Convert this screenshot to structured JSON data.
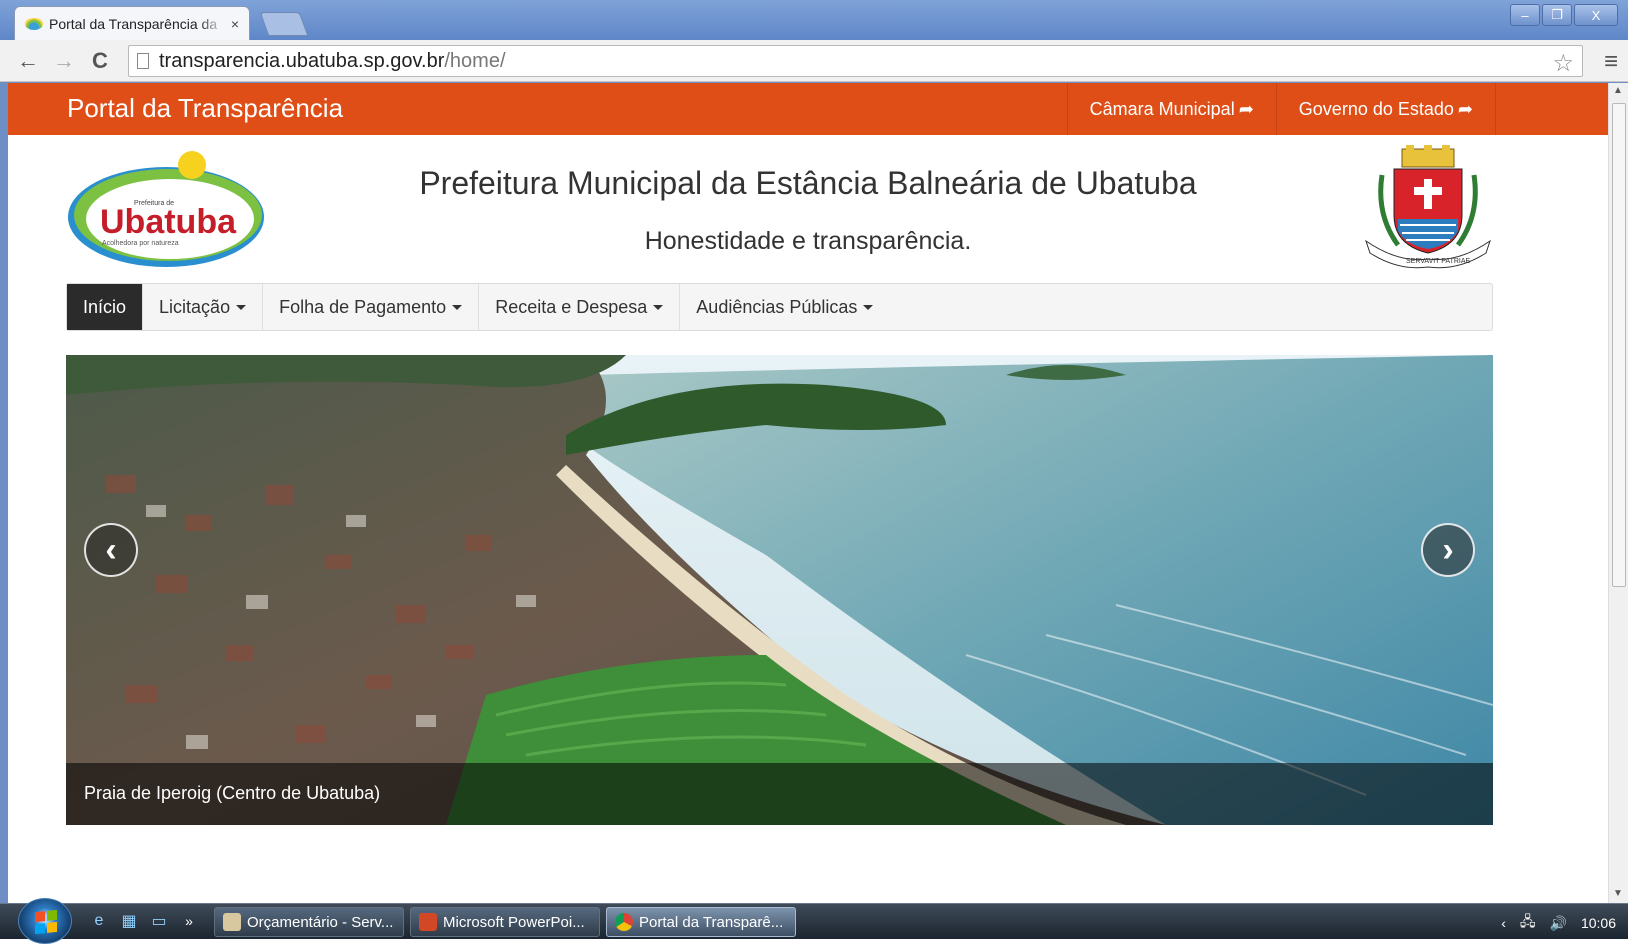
{
  "browser": {
    "tab_title": "Portal da Transparência da",
    "tab_close": "×",
    "url_host": "transparencia.ubatuba.sp.gov.br",
    "url_path": "/home/",
    "back": "←",
    "forward": "→",
    "reload": "C",
    "star": "☆",
    "menu": "≡",
    "minimize": "–",
    "restore": "❐",
    "close": "X"
  },
  "site": {
    "brand": "Portal da Transparência",
    "top_links": [
      {
        "label": "Câmara Municipal",
        "icon": "share-icon"
      },
      {
        "label": "Governo do Estado",
        "icon": "share-icon"
      }
    ],
    "org_name": "Prefeitura Municipal da Estância Balneária de Ubatuba",
    "slogan": "Honestidade e transparência.",
    "logo": {
      "small_text": "Prefeitura de",
      "word": "Ubatuba",
      "tagline": "Acolhedora por natureza"
    },
    "crest_motto": "SERVAVIT PATRIAE",
    "nav": [
      {
        "label": "Início",
        "active": true,
        "dropdown": false
      },
      {
        "label": "Licitação",
        "active": false,
        "dropdown": true
      },
      {
        "label": "Folha de Pagamento",
        "active": false,
        "dropdown": true
      },
      {
        "label": "Receita e Despesa",
        "active": false,
        "dropdown": true
      },
      {
        "label": "Audiências Públicas",
        "active": false,
        "dropdown": true
      }
    ],
    "carousel": {
      "caption": "Praia de Iperoig (Centro de Ubatuba)",
      "prev": "‹",
      "next": "›"
    },
    "colors": {
      "topbar": "#e04e17",
      "nav_active": "#2b2b2b"
    }
  },
  "taskbar": {
    "more": "»",
    "tasks": [
      {
        "label": "Orçamentário - Serv...",
        "active": false
      },
      {
        "label": "Microsoft PowerPoi...",
        "active": false
      },
      {
        "label": "Portal da Transparê...",
        "active": true
      }
    ],
    "clock": "10:06",
    "tray_arrow": "‹"
  }
}
